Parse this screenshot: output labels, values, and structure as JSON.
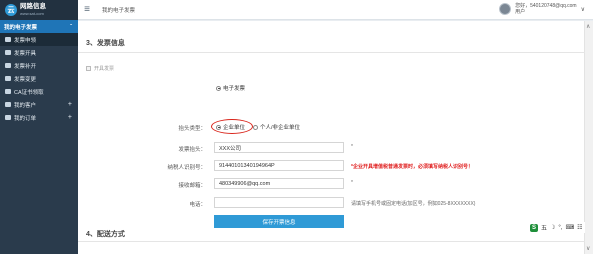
{
  "logo": {
    "mark": "云",
    "name": "网路信息",
    "sub": "www.sat-com"
  },
  "sidebar": {
    "group": {
      "label": "我的电子发票",
      "caret": "ˇ"
    },
    "items": [
      {
        "label": "发票申领"
      },
      {
        "label": "发票开具"
      },
      {
        "label": "发票补开"
      },
      {
        "label": "发票变更"
      },
      {
        "label": "CA证书领取"
      },
      {
        "label": "我的客户",
        "plus": "+"
      },
      {
        "label": "我的订单",
        "plus": "+"
      }
    ]
  },
  "topbar": {
    "menu_icon": "≡",
    "breadcrumb": "我的电子发票",
    "user_line1": "您好，540120748@qq.com",
    "user_line2": "用户",
    "caret": "∨"
  },
  "section3": {
    "title": "3、发票信息"
  },
  "invoice_open": {
    "label": "开具发票"
  },
  "invoice_type": {
    "option": "电子发票"
  },
  "title_type": {
    "label": "抬头类型：",
    "option_company": "企业单位",
    "option_personal": "个人/非企业单位"
  },
  "fields": {
    "title": {
      "label": "发票抬头：",
      "value": "XXX公司",
      "mark": "*"
    },
    "tax_id": {
      "label": "纳税人识别号：",
      "value": "91440101340194964P",
      "warning": "*企业开具增值税普通发票时，必须填写纳税人识别号！"
    },
    "email": {
      "label": "接收邮箱：",
      "value": "480349906@qq.com",
      "mark": "*"
    },
    "phone": {
      "label": "电话：",
      "value": "",
      "hint": "请填写手机号或固定电话(加区号，例如025-8XXXXXXX)"
    }
  },
  "save_button": {
    "label": "保存开票信息"
  },
  "section4": {
    "title": "4、配送方式"
  },
  "ime": {
    "logo": "S",
    "items": [
      "五",
      "☽",
      "°,",
      "⌨",
      "☷"
    ]
  },
  "scroll": {
    "up": "∧",
    "down": "∨"
  }
}
